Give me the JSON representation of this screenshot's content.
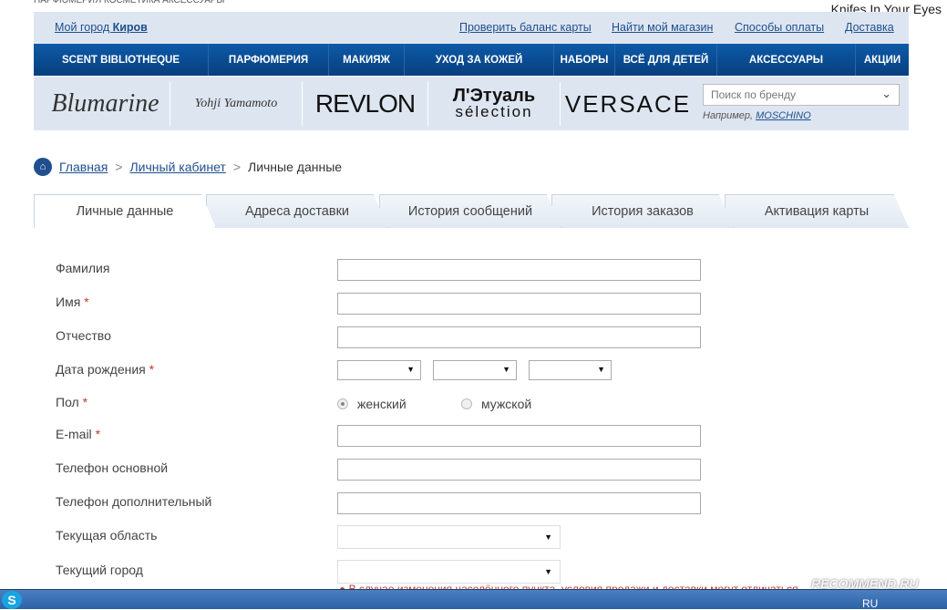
{
  "overlay": {
    "watermark": "Knifes In Your Eyes",
    "recommend": "RECOMMEND.RU"
  },
  "top_links": {
    "city_prefix": "Мой город ",
    "city": "Киров",
    "links": [
      "Проверить баланс карты",
      "Найти мой магазин",
      "Способы оплаты",
      "Доставка"
    ]
  },
  "nav": [
    "SCENT BIBLIOTHEQUE",
    "ПАРФЮМЕРИЯ",
    "МАКИЯЖ",
    "УХОД ЗА КОЖЕЙ",
    "НАБОРЫ",
    "ВСЁ ДЛЯ ДЕТЕЙ",
    "АКСЕССУАРЫ",
    "АКЦИИ"
  ],
  "brands": [
    "Blumarine",
    "Yohji Yamamoto",
    "REVLON",
    "Л'Этуаль",
    "sélection",
    "VERSACE"
  ],
  "brand_search": {
    "placeholder": "Поиск по бренду",
    "hint": "Например,",
    "example": "MOSCHINO"
  },
  "breadcrumb": [
    "Главная",
    "Личный кабинет",
    "Личные данные"
  ],
  "tabs": [
    "Личные данные",
    "Адреса доставки",
    "История сообщений",
    "История заказов",
    "Активация карты"
  ],
  "active_tab": 0,
  "form": {
    "fields": [
      "Фамилия",
      "Имя",
      "Отчество",
      "Дата рождения",
      "Пол",
      "E-mail",
      "Телефон основной",
      "Телефон дополнительный",
      "Текущая область",
      "Текущий город"
    ],
    "required_mark": "*",
    "gender_options": [
      "женский",
      "мужской"
    ],
    "gender_selected": "женский",
    "city_warning": "В случае изменения населённого пункта, условия продажи и доставки могут отличаться"
  },
  "taskbar": {
    "lang": "RU"
  },
  "colors": {
    "nav": "#0a4c94",
    "link": "#1f4f8f",
    "panel": "#dde6f0",
    "required": "#c0392b"
  }
}
